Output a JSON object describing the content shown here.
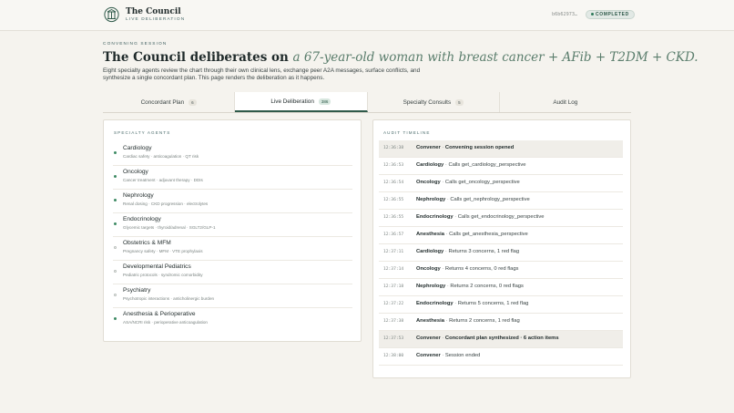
{
  "brand": {
    "title": "The Council",
    "subtitle": "Live Deliberation"
  },
  "session": {
    "id": "b6b62973…",
    "status": "COMPLETED"
  },
  "hero": {
    "eyebrow": "Convening Session",
    "title_plain": "The Council deliberates on",
    "title_emphasis": "a 67-year-old woman with breast cancer + AFib + T2DM + CKD.",
    "subtitle": "Eight specialty agents review the chart through their own clinical lens, exchange peer A2A messages, surface conflicts, and synthesize a single concordant plan. This page renders the deliberation as it happens."
  },
  "tabs": [
    {
      "label": "Concordant Plan",
      "count": "6"
    },
    {
      "label": "Live Deliberation",
      "count": "386"
    },
    {
      "label": "Specialty Consults",
      "count": "5"
    },
    {
      "label": "Audit Log",
      "count": ""
    }
  ],
  "agents_title": "Specialty Agents",
  "agents": [
    {
      "name": "Cardiology",
      "desc": "Cardiac safety · anticoagulation · QT risk",
      "active": true
    },
    {
      "name": "Oncology",
      "desc": "Cancer treatment · adjuvant therapy · DDIs",
      "active": true
    },
    {
      "name": "Nephrology",
      "desc": "Renal dosing · CKD progression · electrolytes",
      "active": true
    },
    {
      "name": "Endocrinology",
      "desc": "Glycemic targets · thyroid/adrenal · SGLT2/GLP-1",
      "active": true
    },
    {
      "name": "Obstetrics & MFM",
      "desc": "Pregnancy safety · MFM · VTE prophylaxis",
      "active": false
    },
    {
      "name": "Developmental Pediatrics",
      "desc": "Pediatric protocols · syndromic comorbidity",
      "active": false
    },
    {
      "name": "Psychiatry",
      "desc": "Psychotropic interactions · anticholinergic burden",
      "active": false
    },
    {
      "name": "Anesthesia & Perioperative",
      "desc": "ASA/NCRI risk · perioperative anticoagulation",
      "active": true
    }
  ],
  "timeline_title": "Audit Timeline",
  "timeline": [
    {
      "time": "12:36:38",
      "who": "Convener",
      "msg": "Convening session opened",
      "shaded": true,
      "strong": true
    },
    {
      "time": "12:36:53",
      "who": "Cardiology",
      "msg": "Calls get_cardiology_perspective",
      "shaded": false,
      "strong": false
    },
    {
      "time": "12:36:54",
      "who": "Oncology",
      "msg": "Calls get_oncology_perspective",
      "shaded": false,
      "strong": false
    },
    {
      "time": "12:36:55",
      "who": "Nephrology",
      "msg": "Calls get_nephrology_perspective",
      "shaded": false,
      "strong": false
    },
    {
      "time": "12:36:55",
      "who": "Endocrinology",
      "msg": "Calls get_endocrinology_perspective",
      "shaded": false,
      "strong": false
    },
    {
      "time": "12:36:57",
      "who": "Anesthesia",
      "msg": "Calls get_anesthesia_perspective",
      "shaded": false,
      "strong": false
    },
    {
      "time": "12:37:11",
      "who": "Cardiology",
      "msg": "Returns 3 concerns, 1 red flag",
      "shaded": false,
      "strong": false
    },
    {
      "time": "12:37:14",
      "who": "Oncology",
      "msg": "Returns 4 concerns, 0 red flags",
      "shaded": false,
      "strong": false
    },
    {
      "time": "12:37:18",
      "who": "Nephrology",
      "msg": "Returns 2 concerns, 0 red flags",
      "shaded": false,
      "strong": false
    },
    {
      "time": "12:37:22",
      "who": "Endocrinology",
      "msg": "Returns 5 concerns, 1 red flag",
      "shaded": false,
      "strong": false
    },
    {
      "time": "12:37:38",
      "who": "Anesthesia",
      "msg": "Returns 2 concerns, 1 red flag",
      "shaded": false,
      "strong": false
    },
    {
      "time": "12:37:53",
      "who": "Convener",
      "msg": "Concordant plan synthesized · 6 action items",
      "shaded": true,
      "strong": true
    },
    {
      "time": "12:38:00",
      "who": "Convener",
      "msg": "Session ended",
      "shaded": false,
      "strong": false
    }
  ],
  "colors": {
    "accent": "#2f5a4a",
    "active_dot": "#3d8a63",
    "emphasis": "#5a7d6c"
  }
}
